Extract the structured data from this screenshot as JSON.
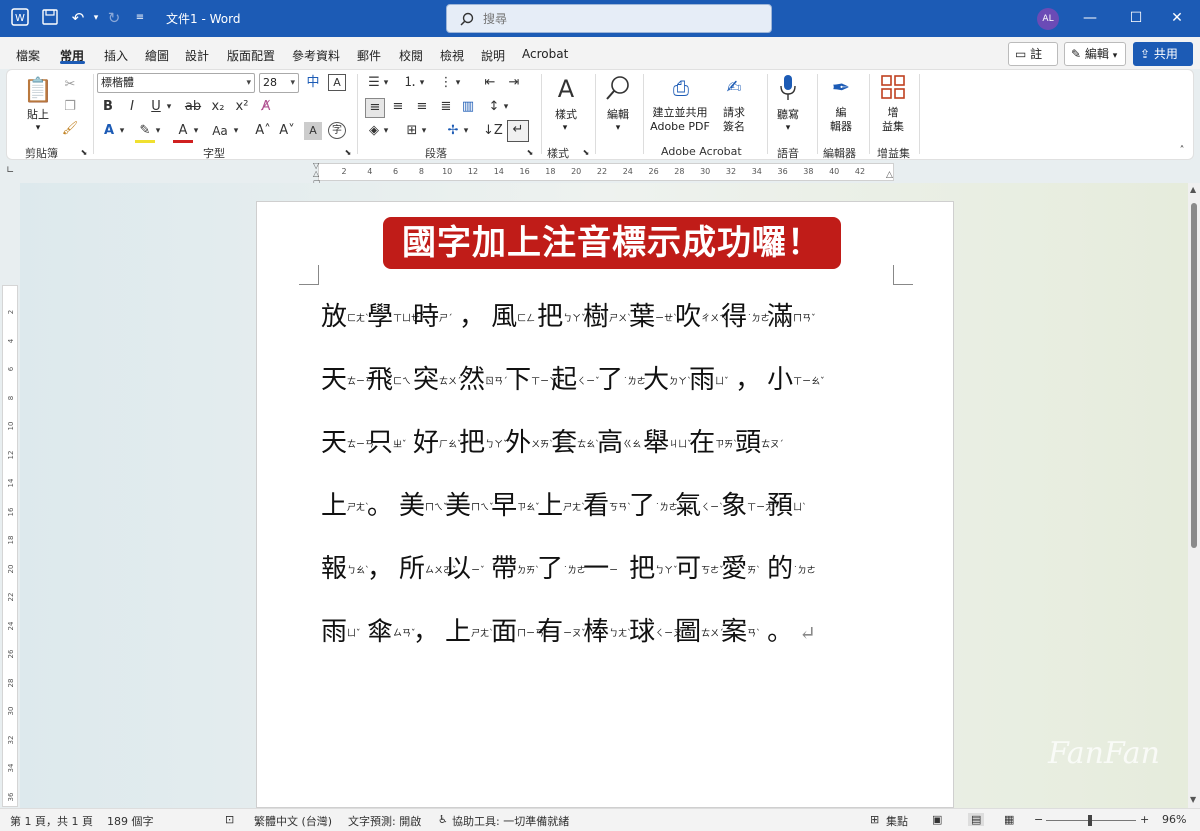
{
  "titlebar": {
    "doc_title": "文件1 - Word",
    "search_placeholder": "搜尋",
    "avatar": "AL"
  },
  "menu": {
    "tabs": [
      "檔案",
      "常用",
      "插入",
      "繪圖",
      "設計",
      "版面配置",
      "參考資料",
      "郵件",
      "校閱",
      "檢視",
      "說明",
      "Acrobat"
    ],
    "active_index": 1,
    "comments": "註解",
    "editing": "編輯",
    "share": "共用"
  },
  "ribbon": {
    "paste": "貼上",
    "clipboard": "剪貼簿",
    "font_name": "標楷體",
    "font_size": "28",
    "font_group": "字型",
    "paragraph_group": "段落",
    "styles": "樣式",
    "styles_group": "樣式",
    "editing": "編輯",
    "create_share_pdf_1": "建立並共用",
    "create_share_pdf_2": "Adobe PDF",
    "request_sign_1": "請求",
    "request_sign_2": "簽名",
    "acrobat_group": "Adobe Acrobat",
    "dictate": "聽寫",
    "voice_group": "語音",
    "editor_1": "編",
    "editor_2": "輯器",
    "editor_group": "編輯器",
    "addins_1": "增",
    "addins_2": "益集",
    "addins_group": "增益集"
  },
  "ruler": {
    "ticks": [
      "2",
      "4",
      "6",
      "8",
      "10",
      "12",
      "14",
      "16",
      "18",
      "20",
      "22",
      "24",
      "26",
      "28",
      "30",
      "32",
      "34",
      "36",
      "38",
      "40",
      "42"
    ],
    "vticks": [
      "2",
      "4",
      "6",
      "8",
      "10",
      "12",
      "14",
      "16",
      "18",
      "20",
      "22",
      "24",
      "26",
      "28",
      "30",
      "32",
      "34",
      "36"
    ]
  },
  "document": {
    "banner": "國字加上注音標示成功囉！",
    "lines": [
      [
        [
          "放",
          "ㄈㄤˋ"
        ],
        [
          "學",
          "ㄒㄩㄝˊ"
        ],
        [
          "時",
          "ㄕˊ"
        ],
        [
          "，",
          ""
        ],
        [
          "風",
          "ㄈㄥ"
        ],
        [
          "把",
          "ㄅㄚˇ"
        ],
        [
          "樹",
          "ㄕㄨˋ"
        ],
        [
          "葉",
          "ㄧㄝˋ"
        ],
        [
          "吹",
          "ㄔㄨㄟ"
        ],
        [
          "得",
          "˙ㄉㄜ"
        ],
        [
          "滿",
          "ㄇㄢˇ"
        ]
      ],
      [
        [
          "天",
          "ㄊㄧㄢ"
        ],
        [
          "飛",
          "ㄈㄟ"
        ],
        [
          "突",
          "ㄊㄨˊ"
        ],
        [
          "然",
          "ㄖㄢˊ"
        ],
        [
          "下",
          "ㄒㄧㄚˋ"
        ],
        [
          "起",
          "ㄑㄧˇ"
        ],
        [
          "了",
          "˙ㄌㄜ"
        ],
        [
          "大",
          "ㄉㄚˋ"
        ],
        [
          "雨",
          "ㄩˇ"
        ],
        [
          "，",
          ""
        ],
        [
          "小",
          "ㄒㄧㄠˇ"
        ]
      ],
      [
        [
          "天",
          "ㄊㄧㄢ"
        ],
        [
          "只",
          "ㄓˇ"
        ],
        [
          "好",
          "ㄏㄠˇ"
        ],
        [
          "把",
          "ㄅㄚˇ"
        ],
        [
          "外",
          "ㄨㄞˋ"
        ],
        [
          "套",
          "ㄊㄠˋ"
        ],
        [
          "高",
          "ㄍㄠ"
        ],
        [
          "舉",
          "ㄐㄩˇ"
        ],
        [
          "在",
          "ㄗㄞˋ"
        ],
        [
          "頭",
          "ㄊㄡˊ"
        ]
      ],
      [
        [
          "上",
          "ㄕㄤˋ"
        ],
        [
          "。",
          ""
        ],
        [
          "美",
          "ㄇㄟˇ"
        ],
        [
          "美",
          "ㄇㄟˇ"
        ],
        [
          "早",
          "ㄗㄠˇ"
        ],
        [
          "上",
          "ㄕㄤˋ"
        ],
        [
          "看",
          "ㄎㄢˋ"
        ],
        [
          "了",
          "˙ㄌㄜ"
        ],
        [
          "氣",
          "ㄑㄧˋ"
        ],
        [
          "象",
          "ㄒㄧㄤˋ"
        ],
        [
          "預",
          "ㄩˋ"
        ]
      ],
      [
        [
          "報",
          "ㄅㄠˋ"
        ],
        [
          "，",
          ""
        ],
        [
          "所",
          "ㄙㄨㄛˇ"
        ],
        [
          "以",
          "ㄧˇ"
        ],
        [
          "帶",
          "ㄉㄞˋ"
        ],
        [
          "了",
          "˙ㄌㄜ"
        ],
        [
          "一",
          "ㄧ"
        ],
        [
          "把",
          "ㄅㄚˇ"
        ],
        [
          "可",
          "ㄎㄜˇ"
        ],
        [
          "愛",
          "ㄞˋ"
        ],
        [
          "的",
          "˙ㄉㄜ"
        ]
      ],
      [
        [
          "雨",
          "ㄩˇ"
        ],
        [
          "傘",
          "ㄙㄢˇ"
        ],
        [
          "，",
          ""
        ],
        [
          "上",
          "ㄕㄤˋ"
        ],
        [
          "面",
          "ㄇㄧㄢˋ"
        ],
        [
          "有",
          "ㄧㄡˇ"
        ],
        [
          "棒",
          "ㄅㄤˋ"
        ],
        [
          "球",
          "ㄑㄧㄡˊ"
        ],
        [
          "圖",
          "ㄊㄨˊ"
        ],
        [
          "案",
          "ㄢˋ"
        ],
        [
          "。",
          ""
        ]
      ]
    ]
  },
  "status": {
    "page": "第 1 頁，共 1 頁",
    "words": "189 個字",
    "language": "繁體中文 (台灣)",
    "prediction": "文字預測: 開啟",
    "accessibility": "協助工具: 一切準備就緒",
    "focus": "集點",
    "zoom": "96%"
  },
  "watermark": "FanFan"
}
